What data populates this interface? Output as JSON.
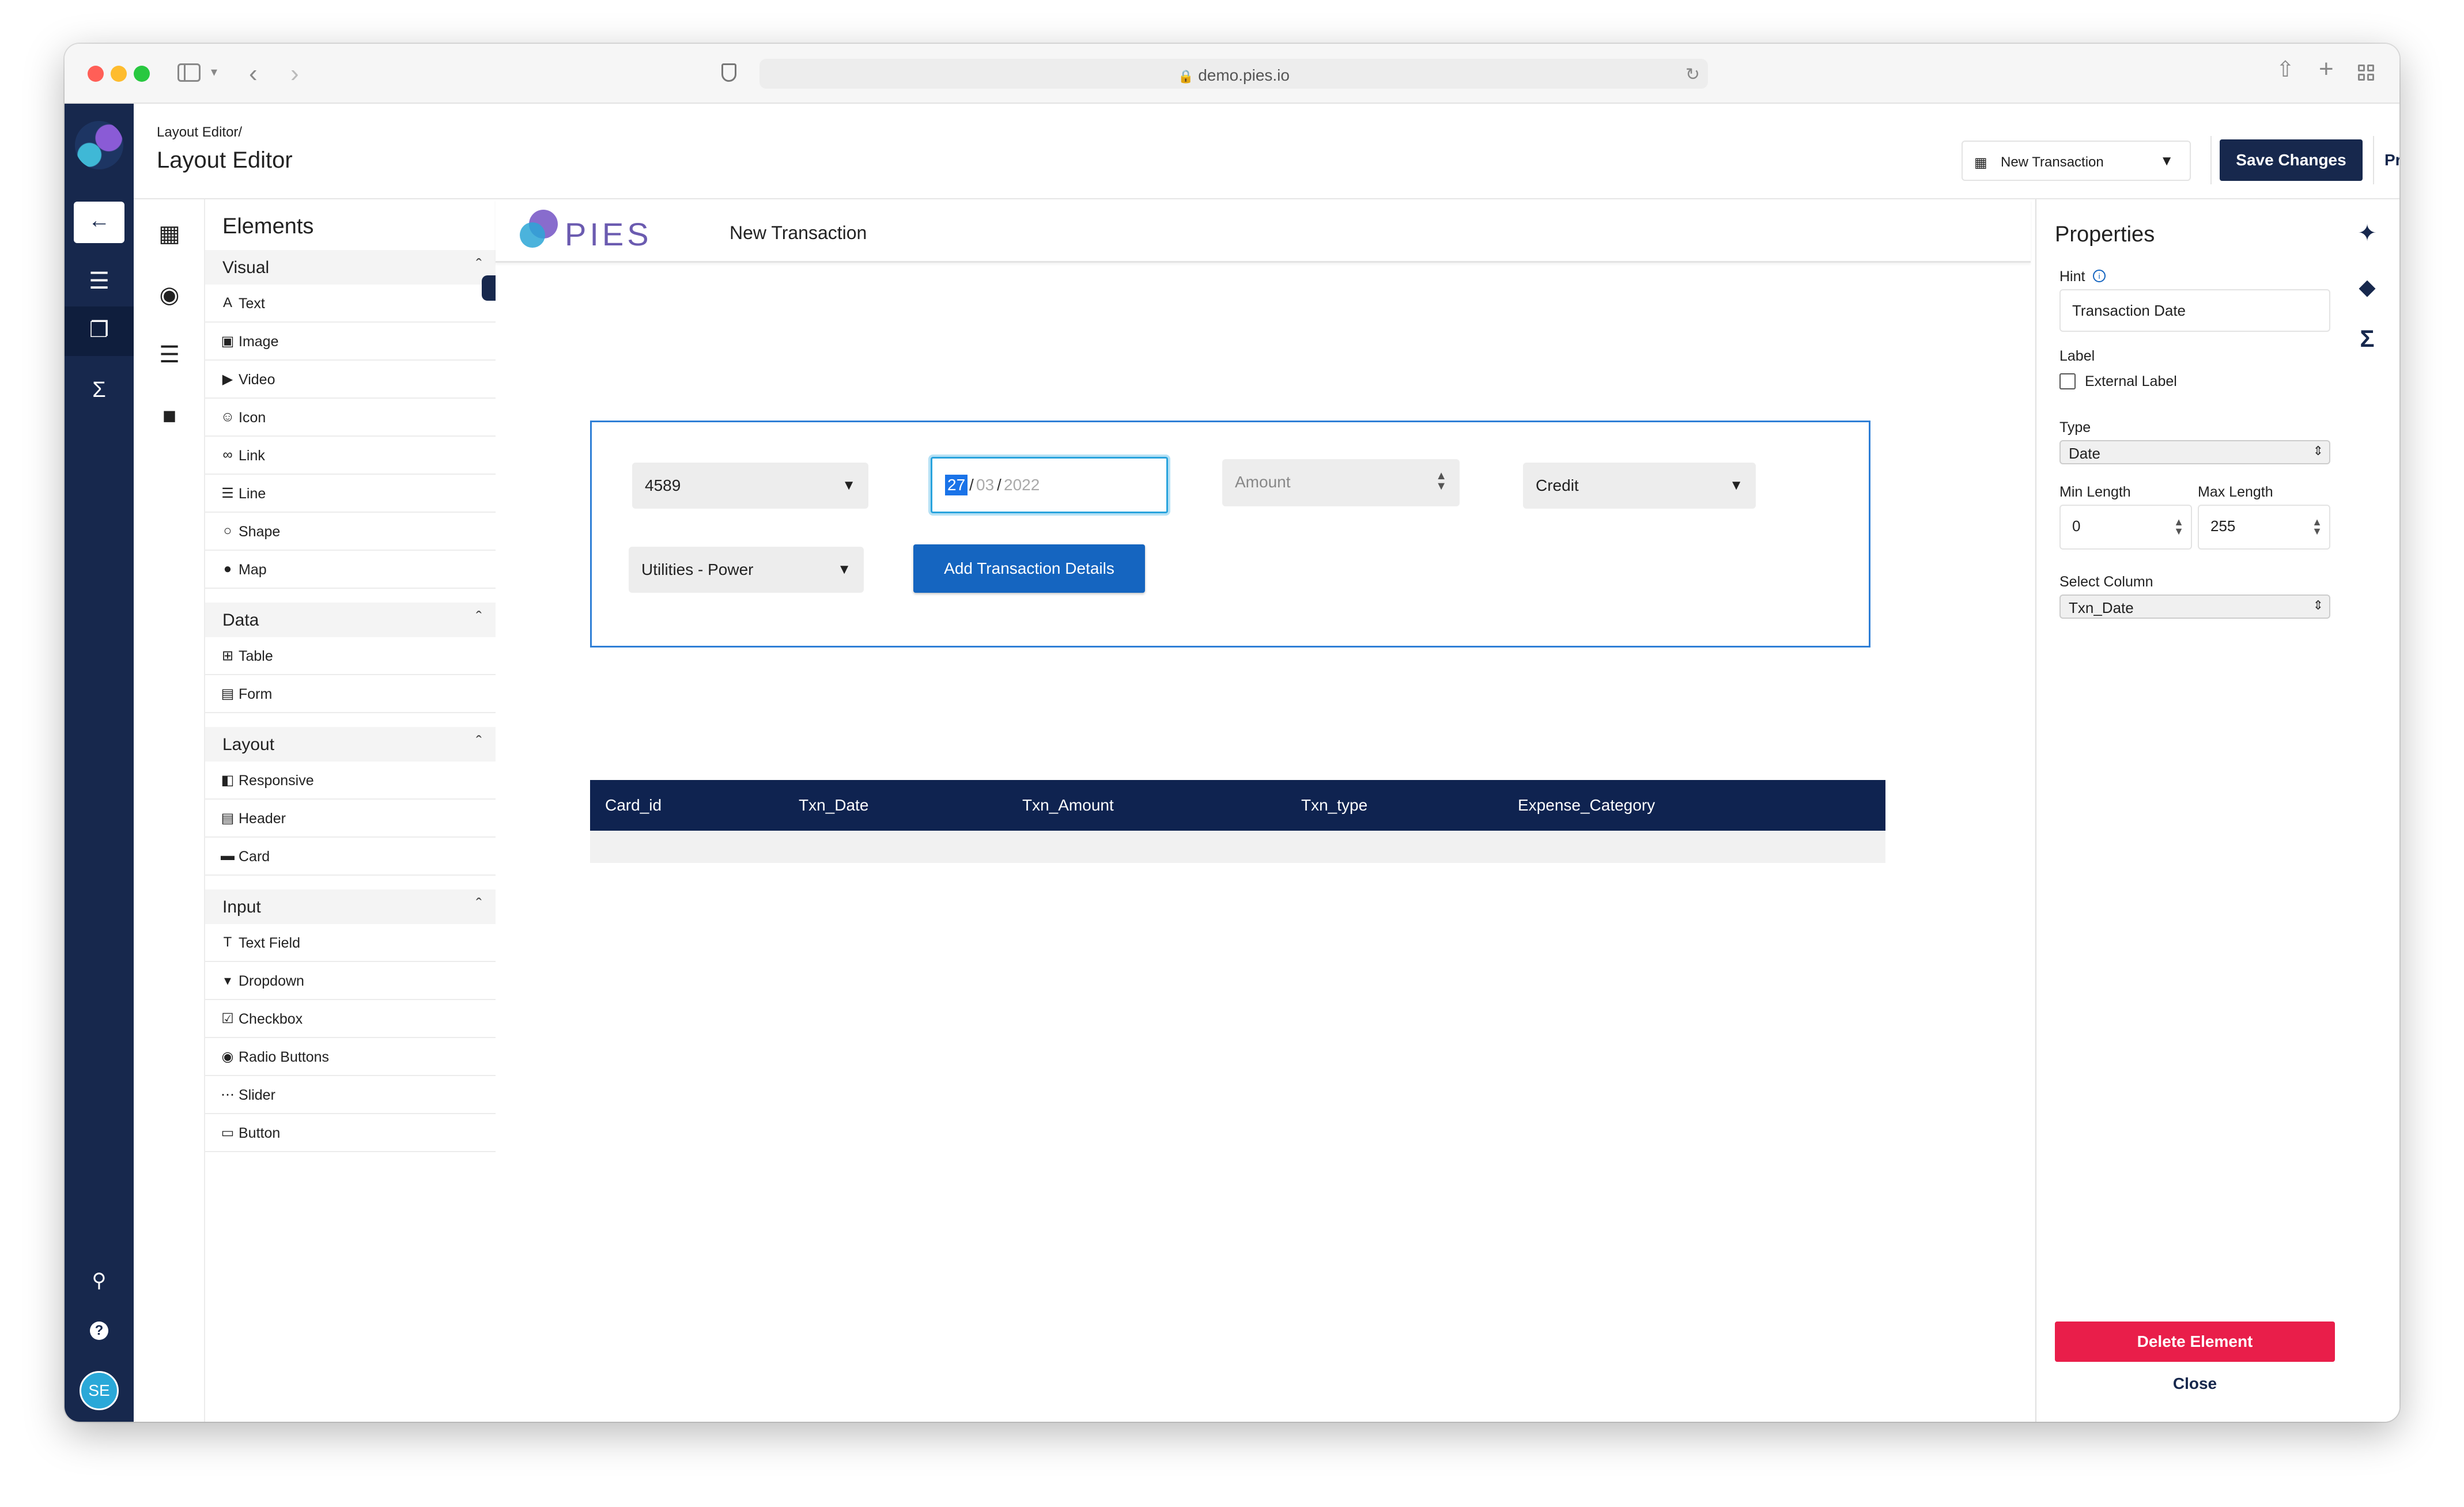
{
  "browser": {
    "url": "demo.pies.io",
    "traffic_colors": [
      "#ff5f57",
      "#febc2e",
      "#28c840"
    ]
  },
  "header": {
    "breadcrumb": "Layout Editor/",
    "title": "Layout Editor",
    "layout_select": "New Transaction",
    "save_label": "Save Changes",
    "preview_label": "Preview"
  },
  "user": {
    "initials": "SE"
  },
  "elements_panel": {
    "title": "Elements",
    "sections": [
      {
        "title": "Visual",
        "items": [
          {
            "label": "Text",
            "icon": "text-icon"
          },
          {
            "label": "Image",
            "icon": "image-icon"
          },
          {
            "label": "Video",
            "icon": "video-icon"
          },
          {
            "label": "Icon",
            "icon": "smiley-icon"
          },
          {
            "label": "Link",
            "icon": "link-icon"
          },
          {
            "label": "Line",
            "icon": "line-icon"
          },
          {
            "label": "Shape",
            "icon": "circle-icon"
          },
          {
            "label": "Map",
            "icon": "pin-icon"
          }
        ]
      },
      {
        "title": "Data",
        "items": [
          {
            "label": "Table",
            "icon": "table-icon"
          },
          {
            "label": "Form",
            "icon": "form-icon"
          }
        ]
      },
      {
        "title": "Layout",
        "items": [
          {
            "label": "Responsive",
            "icon": "responsive-icon"
          },
          {
            "label": "Header",
            "icon": "header-icon"
          },
          {
            "label": "Card",
            "icon": "card-icon"
          }
        ]
      },
      {
        "title": "Input",
        "items": [
          {
            "label": "Text Field",
            "icon": "textfield-icon"
          },
          {
            "label": "Dropdown",
            "icon": "dropdown-icon"
          },
          {
            "label": "Checkbox",
            "icon": "checkbox-icon"
          },
          {
            "label": "Radio Buttons",
            "icon": "radio-icon"
          },
          {
            "label": "Slider",
            "icon": "slider-icon"
          },
          {
            "label": "Button",
            "icon": "button-icon"
          }
        ]
      }
    ]
  },
  "canvas": {
    "brand": "PIES",
    "page_title": "New Transaction",
    "form": {
      "card_id": "4589",
      "date_day": "27",
      "date_month": "03",
      "date_year": "2022",
      "date_sep": "/",
      "amount_placeholder": "Amount",
      "txn_type": "Credit",
      "category": "Utilities - Power",
      "submit_label": "Add Transaction Details"
    },
    "table": {
      "columns": [
        "Card_id",
        "Txn_Date",
        "Txn_Amount",
        "Txn_type",
        "Expense_Category"
      ]
    }
  },
  "properties": {
    "title": "Properties",
    "hint_label": "Hint",
    "hint_value": "Transaction Date",
    "label_label": "Label",
    "external_label": "External Label",
    "type_label": "Type",
    "type_value": "Date",
    "min_label": "Min Length",
    "min_value": "0",
    "max_label": "Max Length",
    "max_value": "255",
    "column_label": "Select Column",
    "column_value": "Txn_Date",
    "delete_label": "Delete Element",
    "close_label": "Close"
  },
  "colors": {
    "navy": "#17284d",
    "primary_blue": "#1565c0",
    "delete_red": "#e91e4a",
    "focus_blue": "#29a3dd"
  }
}
